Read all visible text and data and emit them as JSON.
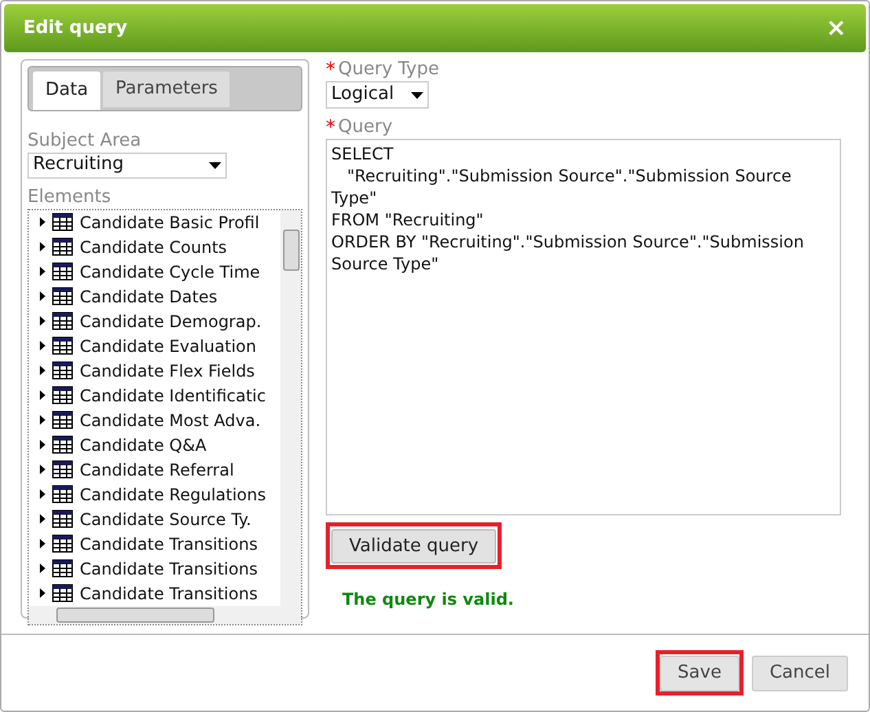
{
  "dialog": {
    "title": "Edit query",
    "close": "×"
  },
  "tabs": [
    {
      "label": "Data",
      "selected": true
    },
    {
      "label": "Parameters",
      "selected": false
    }
  ],
  "subject_area": {
    "label": "Subject Area",
    "value": "Recruiting"
  },
  "elements": {
    "label": "Elements",
    "items": [
      "Candidate Basic Profil",
      "Candidate Counts",
      "Candidate Cycle Time",
      "Candidate Dates",
      "Candidate Demograp.",
      "Candidate Evaluation",
      "Candidate Flex Fields",
      "Candidate Identificatic",
      "Candidate Most Adva.",
      "Candidate Q&A",
      "Candidate Referral",
      "Candidate Regulations",
      "Candidate Source Ty.",
      "Candidate Transitions",
      "Candidate Transitions",
      "Candidate Transitions"
    ]
  },
  "query_type": {
    "label": "Query Type",
    "required_mark": "*",
    "value": "Logical"
  },
  "query": {
    "label": "Query",
    "required_mark": "*",
    "lines": [
      "SELECT",
      "   \"Recruiting\".\"Submission Source\".\"Submission Source",
      "Type\"",
      "FROM \"Recruiting\"",
      "ORDER BY \"Recruiting\".\"Submission Source\".\"Submission",
      "Source Type\""
    ]
  },
  "validate_button": {
    "label": "Validate query",
    "highlighted": true
  },
  "status": "The query is valid.",
  "buttons": [
    {
      "label": "Save",
      "highlighted": true
    },
    {
      "label": "Cancel",
      "highlighted": false
    }
  ]
}
